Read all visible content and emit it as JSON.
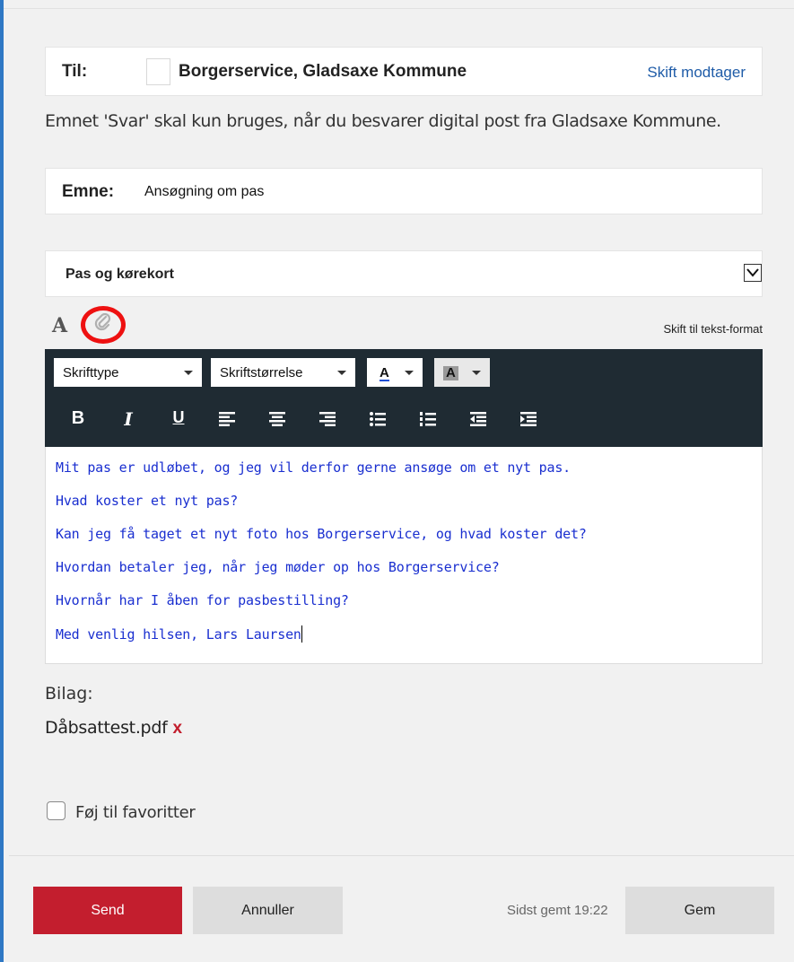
{
  "recipient": {
    "label": "Til:",
    "name": "Borgerservice, Gladsaxe Kommune",
    "change_link": "Skift modtager"
  },
  "notice": "Emnet 'Svar' skal kun bruges, når du besvarer digital post fra Gladsaxe Kommune.",
  "subject": {
    "label": "Emne:",
    "value": "Ansøgning om pas"
  },
  "category": {
    "selected": "Pas og kørekort"
  },
  "editor_tools": {
    "format_icon_letter": "A",
    "switch_format": "Skift til tekst-format"
  },
  "toolbar": {
    "font_dropdown": "Skrifttype",
    "size_dropdown": "Skriftstørrelse",
    "text_color_letter": "A",
    "bg_color_letter": "A",
    "bold": "B",
    "italic": "I",
    "underline": "U"
  },
  "message_lines": [
    "Mit pas er udløbet, og jeg vil derfor gerne ansøge om et nyt pas.",
    "Hvad koster et nyt pas?",
    "Kan jeg få taget et nyt foto hos Borgerservice, og hvad koster det?",
    "Hvordan betaler jeg, når jeg møder op hos Borgerservice?",
    "Hvornår har I åben for pasbestilling?",
    "Med venlig hilsen, Lars Laursen"
  ],
  "attachments": {
    "label": "Bilag:",
    "files": [
      "Dåbsattest.pdf"
    ],
    "remove_symbol": "x"
  },
  "favorites": {
    "label": "Føj til favoritter",
    "checked": false
  },
  "footer": {
    "send": "Send",
    "cancel": "Annuller",
    "saved_status": "Sidst gemt 19:22",
    "save": "Gem"
  },
  "colors": {
    "send_button": "#c31e2e",
    "toolbar_bg": "#1f2b33",
    "message_text": "#1a2fd0",
    "link": "#1f5ca8",
    "highlight_ring": "#e11111"
  }
}
